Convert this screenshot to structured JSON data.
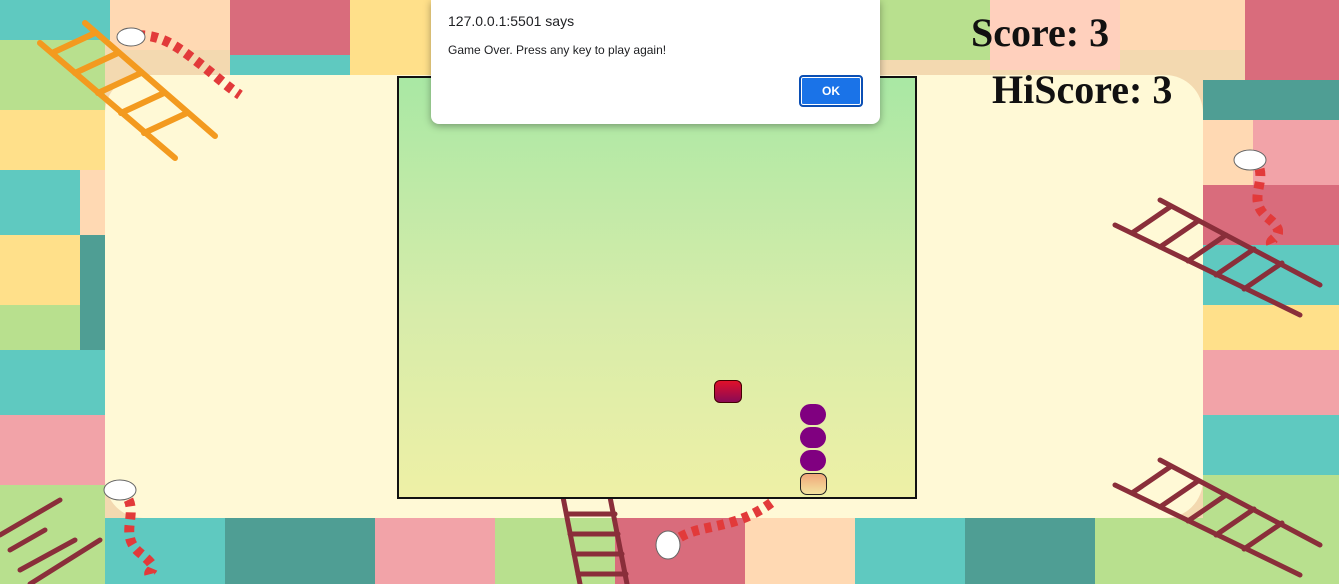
{
  "dialog": {
    "title": "127.0.0.1:5501 says",
    "message": "Game Over. Press any key to play again!",
    "ok_label": "OK"
  },
  "scoreboard": {
    "score_text": "Score: 3",
    "hiscore_text": "HiScore: 3"
  },
  "colors": {
    "board_top": "#a9e8a4",
    "board_bottom": "#eef0a6",
    "snake_body": "#800080",
    "food": "#e0102a",
    "ok_button": "#1a73e8"
  }
}
